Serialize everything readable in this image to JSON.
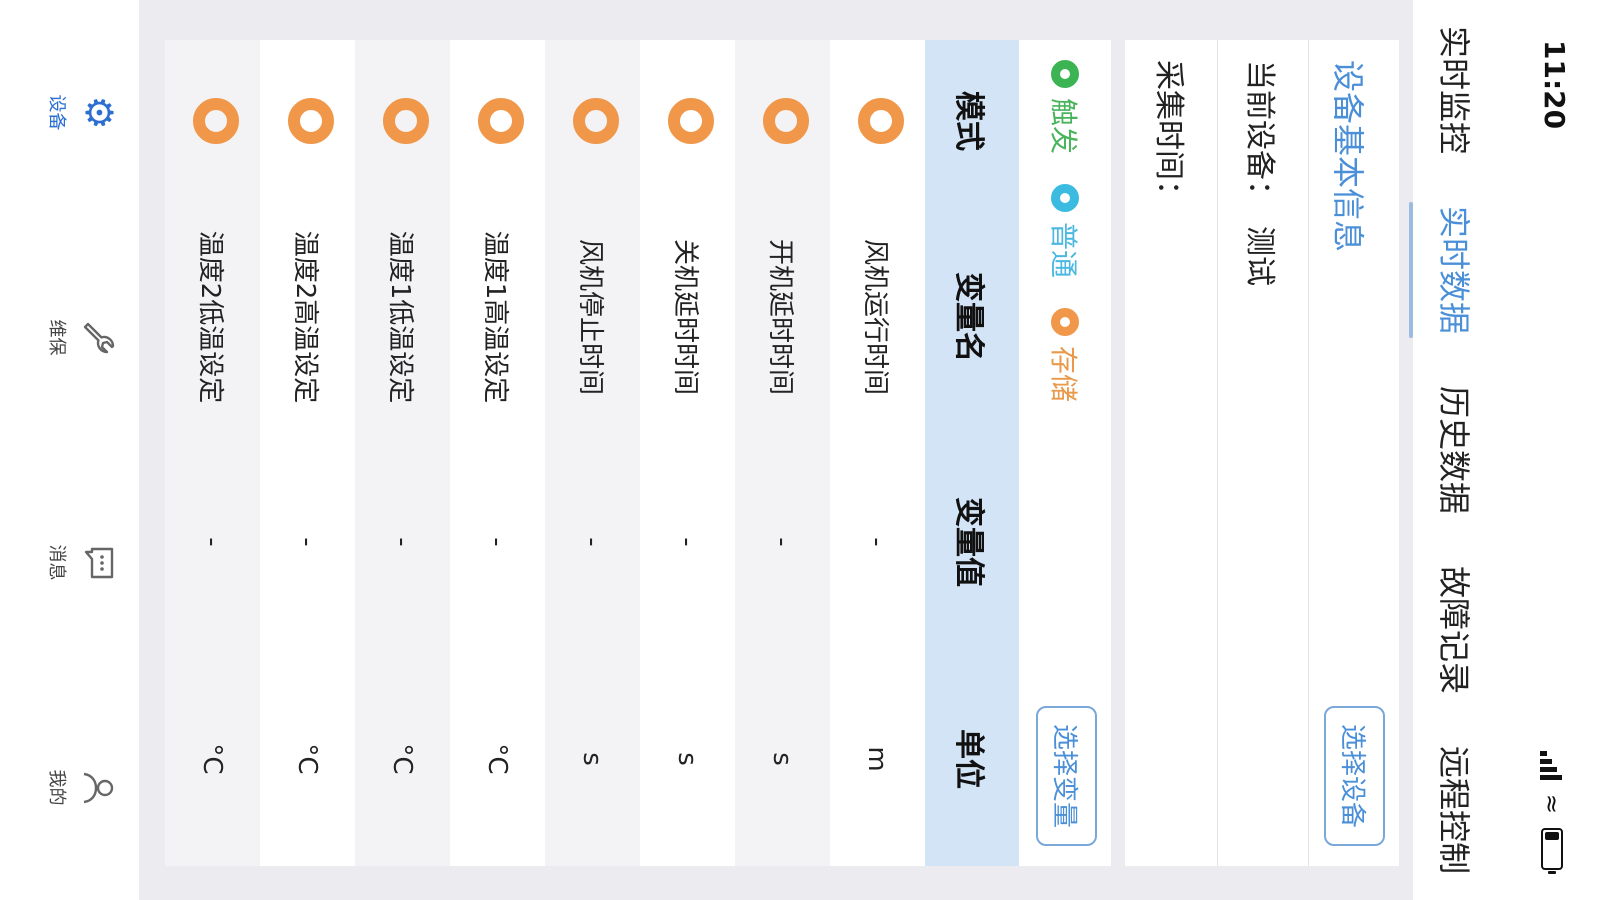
{
  "status_bar": {
    "time": "11:20"
  },
  "tabs": [
    {
      "label": "实时监控"
    },
    {
      "label": "实时数据",
      "active": true
    },
    {
      "label": "历史数据"
    },
    {
      "label": "故障记录"
    },
    {
      "label": "远程控制"
    }
  ],
  "device_info": {
    "title": "设备基本信息",
    "select_button": "选择设备",
    "current_device_label": "当前设备：",
    "current_device_value": "测试",
    "collect_time_label": "采集时间："
  },
  "variables": {
    "legend": [
      {
        "label": "触发",
        "color": "#3cb454"
      },
      {
        "label": "普通",
        "color": "#3bbbe0"
      },
      {
        "label": "存储",
        "color": "#f0974a"
      }
    ],
    "select_button": "选择变量",
    "headers": [
      "模式",
      "变量名",
      "变量值",
      "单位"
    ],
    "rows": [
      {
        "mode": "storage",
        "name": "风机运行时间",
        "value": "-",
        "unit": "m"
      },
      {
        "mode": "storage",
        "name": "开机延时时间",
        "value": "-",
        "unit": "s"
      },
      {
        "mode": "storage",
        "name": "关机延时时间",
        "value": "-",
        "unit": "s"
      },
      {
        "mode": "storage",
        "name": "风机停止时间",
        "value": "-",
        "unit": "s"
      },
      {
        "mode": "storage",
        "name": "温度1高温设定",
        "value": "-",
        "unit": "°C"
      },
      {
        "mode": "storage",
        "name": "温度1低温设定",
        "value": "-",
        "unit": "°C"
      },
      {
        "mode": "storage",
        "name": "温度2高温设定",
        "value": "-",
        "unit": "°C"
      },
      {
        "mode": "storage",
        "name": "温度2低温设定",
        "value": "-",
        "unit": "°C"
      }
    ]
  },
  "bottom_nav": [
    {
      "label": "设备",
      "icon": "gear-icon",
      "active": true
    },
    {
      "label": "维保",
      "icon": "wrench-icon"
    },
    {
      "label": "消息",
      "icon": "message-icon"
    },
    {
      "label": "我的",
      "icon": "user-icon"
    }
  ],
  "colors": {
    "accent": "#4a8fd8",
    "header_bg": "#d2e4f6",
    "storage_ring": "#f0974a"
  }
}
